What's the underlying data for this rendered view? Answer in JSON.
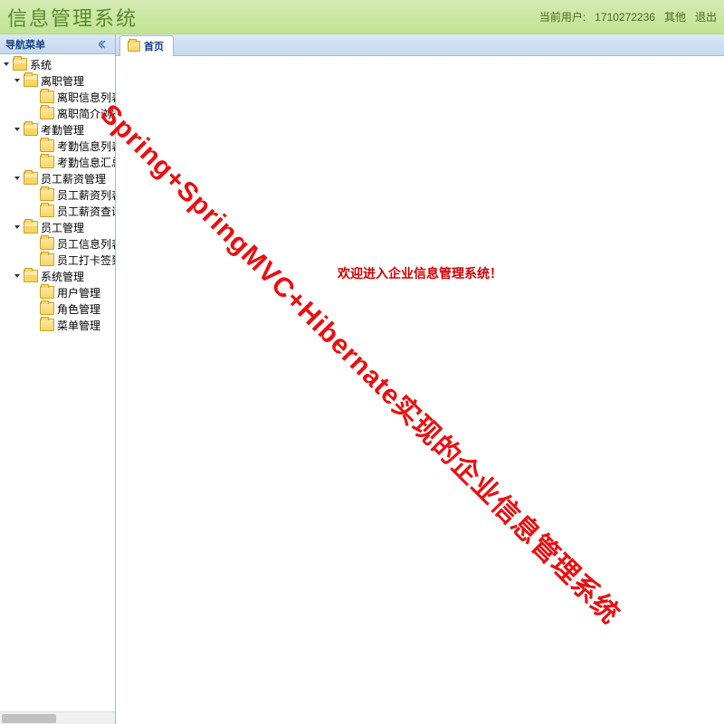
{
  "header": {
    "title": "信息管理系统",
    "user_label": "当前用户:",
    "user_id": "1710272236",
    "other_label": "其他",
    "logout_label": "退出"
  },
  "sidebar": {
    "title": "导航菜单",
    "tree": [
      {
        "level": 0,
        "expanded": true,
        "label": "系统",
        "folder": "open"
      },
      {
        "level": 1,
        "expanded": true,
        "label": "离职管理",
        "folder": "open"
      },
      {
        "level": 2,
        "expanded": false,
        "label": "离职信息列表",
        "folder": "closed"
      },
      {
        "level": 2,
        "expanded": false,
        "label": "离职简介浏览",
        "folder": "closed"
      },
      {
        "level": 1,
        "expanded": true,
        "label": "考勤管理",
        "folder": "open"
      },
      {
        "level": 2,
        "expanded": false,
        "label": "考勤信息列表",
        "folder": "closed"
      },
      {
        "level": 2,
        "expanded": false,
        "label": "考勤信息汇总",
        "folder": "closed"
      },
      {
        "level": 1,
        "expanded": true,
        "label": "员工薪资管理",
        "folder": "open"
      },
      {
        "level": 2,
        "expanded": false,
        "label": "员工薪资列表",
        "folder": "closed"
      },
      {
        "level": 2,
        "expanded": false,
        "label": "员工薪资查询",
        "folder": "closed"
      },
      {
        "level": 1,
        "expanded": true,
        "label": "员工管理",
        "folder": "open"
      },
      {
        "level": 2,
        "expanded": false,
        "label": "员工信息列表",
        "folder": "closed"
      },
      {
        "level": 2,
        "expanded": false,
        "label": "员工打卡签到",
        "folder": "closed"
      },
      {
        "level": 1,
        "expanded": true,
        "label": "系统管理",
        "folder": "open"
      },
      {
        "level": 2,
        "expanded": false,
        "label": "用户管理",
        "folder": "closed"
      },
      {
        "level": 2,
        "expanded": false,
        "label": "角色管理",
        "folder": "closed"
      },
      {
        "level": 2,
        "expanded": false,
        "label": "菜单管理",
        "folder": "closed"
      }
    ]
  },
  "main": {
    "tab_label": "首页",
    "welcome_text": "欢迎进入企业信息管理系统！"
  },
  "watermark": {
    "text": "Spring+SpringMVC+Hibernate实现的企业信息管理系统"
  }
}
